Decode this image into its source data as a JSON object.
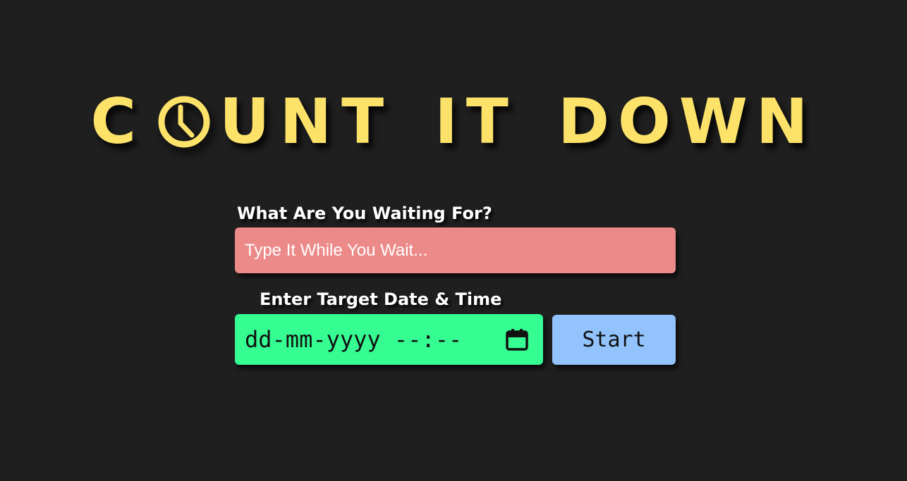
{
  "title": {
    "first_letter": "C",
    "first_rest": "UNT",
    "second": "IT",
    "third": "DOWN",
    "o_icon": "clock-icon",
    "color": "#fde26a"
  },
  "form": {
    "event_label": "What Are You Waiting For?",
    "event_placeholder": "Type It While You Wait...",
    "event_value": "",
    "event_bg": "#ec8a89",
    "date_label": "Enter Target Date & Time",
    "date_value": "dd-mm-yyyy --:--",
    "date_bg": "#36fd92",
    "calendar_icon": "calendar-icon",
    "start_label": "Start",
    "start_bg": "#92c3fd"
  },
  "background": "#1f1f1f"
}
